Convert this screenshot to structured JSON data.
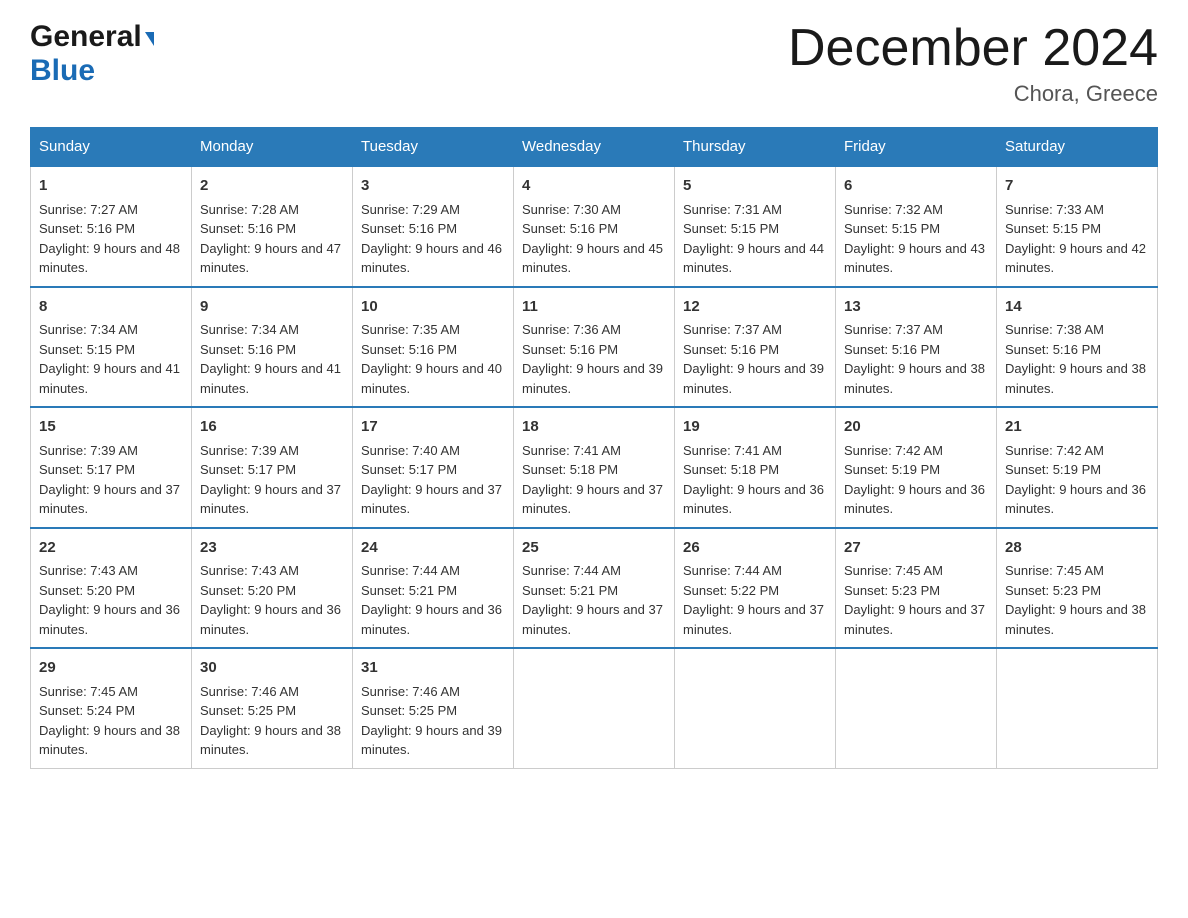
{
  "header": {
    "logo": {
      "general": "General",
      "blue": "Blue",
      "arrow": "▶"
    },
    "title": "December 2024",
    "location": "Chora, Greece"
  },
  "days_of_week": [
    "Sunday",
    "Monday",
    "Tuesday",
    "Wednesday",
    "Thursday",
    "Friday",
    "Saturday"
  ],
  "weeks": [
    [
      {
        "day": "1",
        "sunrise": "7:27 AM",
        "sunset": "5:16 PM",
        "daylight": "9 hours and 48 minutes."
      },
      {
        "day": "2",
        "sunrise": "7:28 AM",
        "sunset": "5:16 PM",
        "daylight": "9 hours and 47 minutes."
      },
      {
        "day": "3",
        "sunrise": "7:29 AM",
        "sunset": "5:16 PM",
        "daylight": "9 hours and 46 minutes."
      },
      {
        "day": "4",
        "sunrise": "7:30 AM",
        "sunset": "5:16 PM",
        "daylight": "9 hours and 45 minutes."
      },
      {
        "day": "5",
        "sunrise": "7:31 AM",
        "sunset": "5:15 PM",
        "daylight": "9 hours and 44 minutes."
      },
      {
        "day": "6",
        "sunrise": "7:32 AM",
        "sunset": "5:15 PM",
        "daylight": "9 hours and 43 minutes."
      },
      {
        "day": "7",
        "sunrise": "7:33 AM",
        "sunset": "5:15 PM",
        "daylight": "9 hours and 42 minutes."
      }
    ],
    [
      {
        "day": "8",
        "sunrise": "7:34 AM",
        "sunset": "5:15 PM",
        "daylight": "9 hours and 41 minutes."
      },
      {
        "day": "9",
        "sunrise": "7:34 AM",
        "sunset": "5:16 PM",
        "daylight": "9 hours and 41 minutes."
      },
      {
        "day": "10",
        "sunrise": "7:35 AM",
        "sunset": "5:16 PM",
        "daylight": "9 hours and 40 minutes."
      },
      {
        "day": "11",
        "sunrise": "7:36 AM",
        "sunset": "5:16 PM",
        "daylight": "9 hours and 39 minutes."
      },
      {
        "day": "12",
        "sunrise": "7:37 AM",
        "sunset": "5:16 PM",
        "daylight": "9 hours and 39 minutes."
      },
      {
        "day": "13",
        "sunrise": "7:37 AM",
        "sunset": "5:16 PM",
        "daylight": "9 hours and 38 minutes."
      },
      {
        "day": "14",
        "sunrise": "7:38 AM",
        "sunset": "5:16 PM",
        "daylight": "9 hours and 38 minutes."
      }
    ],
    [
      {
        "day": "15",
        "sunrise": "7:39 AM",
        "sunset": "5:17 PM",
        "daylight": "9 hours and 37 minutes."
      },
      {
        "day": "16",
        "sunrise": "7:39 AM",
        "sunset": "5:17 PM",
        "daylight": "9 hours and 37 minutes."
      },
      {
        "day": "17",
        "sunrise": "7:40 AM",
        "sunset": "5:17 PM",
        "daylight": "9 hours and 37 minutes."
      },
      {
        "day": "18",
        "sunrise": "7:41 AM",
        "sunset": "5:18 PM",
        "daylight": "9 hours and 37 minutes."
      },
      {
        "day": "19",
        "sunrise": "7:41 AM",
        "sunset": "5:18 PM",
        "daylight": "9 hours and 36 minutes."
      },
      {
        "day": "20",
        "sunrise": "7:42 AM",
        "sunset": "5:19 PM",
        "daylight": "9 hours and 36 minutes."
      },
      {
        "day": "21",
        "sunrise": "7:42 AM",
        "sunset": "5:19 PM",
        "daylight": "9 hours and 36 minutes."
      }
    ],
    [
      {
        "day": "22",
        "sunrise": "7:43 AM",
        "sunset": "5:20 PM",
        "daylight": "9 hours and 36 minutes."
      },
      {
        "day": "23",
        "sunrise": "7:43 AM",
        "sunset": "5:20 PM",
        "daylight": "9 hours and 36 minutes."
      },
      {
        "day": "24",
        "sunrise": "7:44 AM",
        "sunset": "5:21 PM",
        "daylight": "9 hours and 36 minutes."
      },
      {
        "day": "25",
        "sunrise": "7:44 AM",
        "sunset": "5:21 PM",
        "daylight": "9 hours and 37 minutes."
      },
      {
        "day": "26",
        "sunrise": "7:44 AM",
        "sunset": "5:22 PM",
        "daylight": "9 hours and 37 minutes."
      },
      {
        "day": "27",
        "sunrise": "7:45 AM",
        "sunset": "5:23 PM",
        "daylight": "9 hours and 37 minutes."
      },
      {
        "day": "28",
        "sunrise": "7:45 AM",
        "sunset": "5:23 PM",
        "daylight": "9 hours and 38 minutes."
      }
    ],
    [
      {
        "day": "29",
        "sunrise": "7:45 AM",
        "sunset": "5:24 PM",
        "daylight": "9 hours and 38 minutes."
      },
      {
        "day": "30",
        "sunrise": "7:46 AM",
        "sunset": "5:25 PM",
        "daylight": "9 hours and 38 minutes."
      },
      {
        "day": "31",
        "sunrise": "7:46 AM",
        "sunset": "5:25 PM",
        "daylight": "9 hours and 39 minutes."
      },
      null,
      null,
      null,
      null
    ]
  ],
  "labels": {
    "sunrise_prefix": "Sunrise: ",
    "sunset_prefix": "Sunset: ",
    "daylight_prefix": "Daylight: "
  }
}
